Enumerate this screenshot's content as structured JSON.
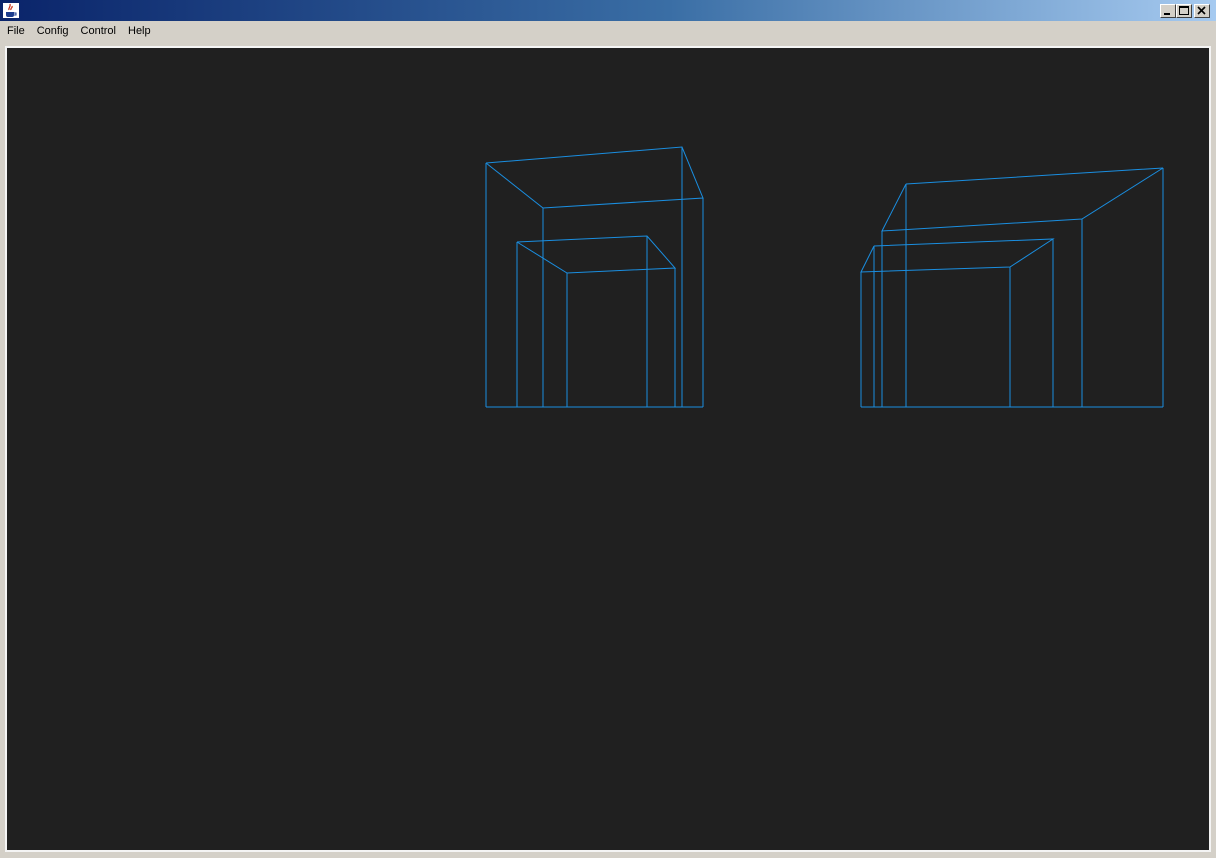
{
  "window": {
    "title": "",
    "icon": "java-cup-icon",
    "controls": {
      "minimize": "minimize-icon",
      "maximize": "maximize-icon",
      "close": "close-icon"
    }
  },
  "menubar": {
    "items": [
      {
        "label": "File"
      },
      {
        "label": "Config"
      },
      {
        "label": "Control"
      },
      {
        "label": "Help"
      }
    ]
  },
  "viewport": {
    "background": "#202020",
    "wireframe_color": "#1a8ee0",
    "scene": "wireframe-boxes"
  }
}
